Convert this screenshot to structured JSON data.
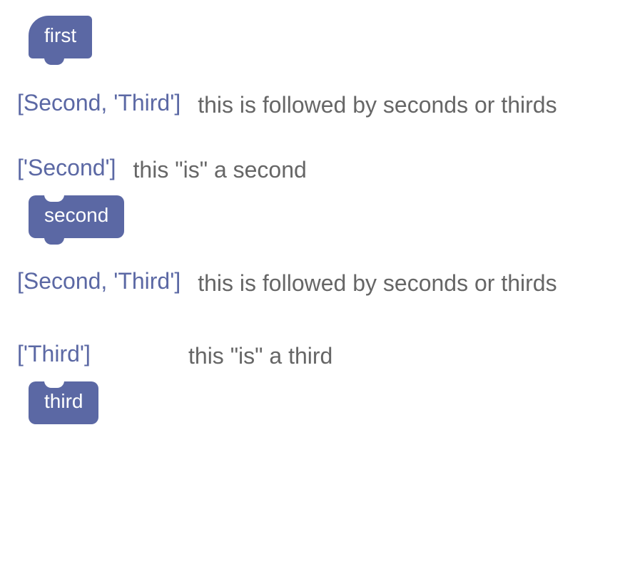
{
  "colors": {
    "block": "#5B68A4",
    "category": "#5B68A4",
    "desc": "#666666",
    "bg": "#ffffff"
  },
  "blocks": {
    "first": "first",
    "second": "second",
    "third": "third"
  },
  "rows": {
    "a": {
      "categories": "[Second, 'Third']",
      "desc": "this is followed by seconds or thirds"
    },
    "b": {
      "categories": "['Second']",
      "desc": "this \"is\" a second"
    },
    "c": {
      "categories": "[Second, 'Third']",
      "desc": "this is followed by seconds or thirds"
    },
    "d": {
      "categories": "['Third']",
      "desc": "this \"is\" a third"
    }
  }
}
